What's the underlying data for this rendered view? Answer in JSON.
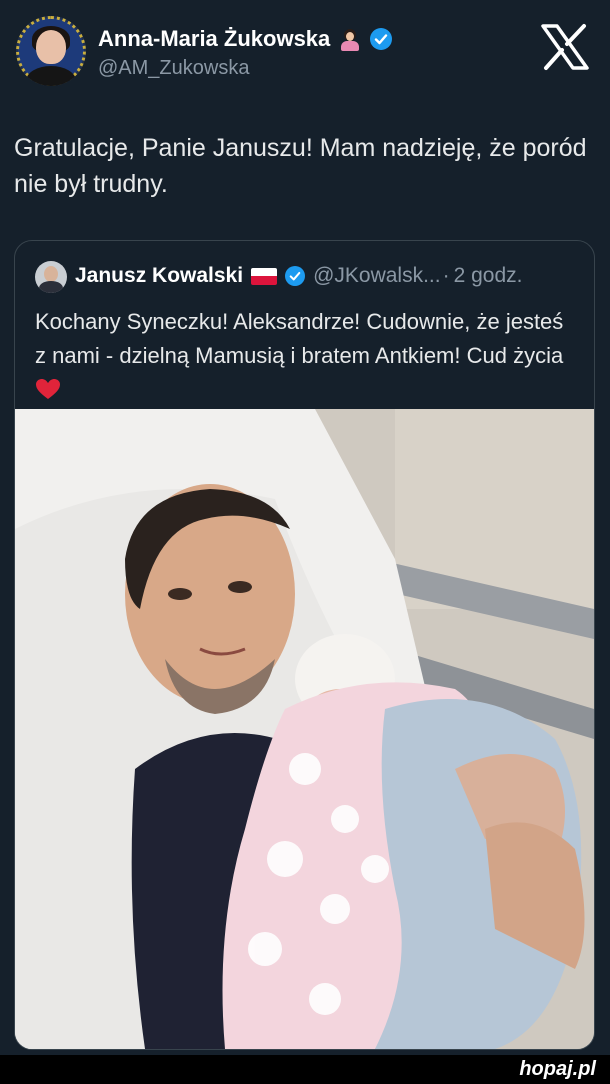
{
  "author": {
    "display_name": "Anna-Maria Żukowska",
    "handle": "@AM_Zukowska",
    "emoji": "woman-tipping-hand-emoji",
    "verified": true
  },
  "tweet": {
    "text": "Gratulacje, Panie Januszu! Mam nadzieję, że poród nie był trudny."
  },
  "quoted": {
    "display_name": "Janusz Kowalski",
    "flag": "poland-flag",
    "verified": true,
    "handle": "@JKowalsk...",
    "separator": "·",
    "time": "2 godz.",
    "text": "Kochany Syneczku! Aleksandrze! Cudownie, że jesteś z nami - dzielną Mamusią i bratem Antkiem! Cud życia",
    "photo": "man-holding-newborn-in-hospital-photo"
  },
  "watermark": "hopaj.pl",
  "colors": {
    "background": "#15202b",
    "accent": "#1d9bf0",
    "secondary_text": "#8b98a5",
    "border": "#38444d"
  }
}
